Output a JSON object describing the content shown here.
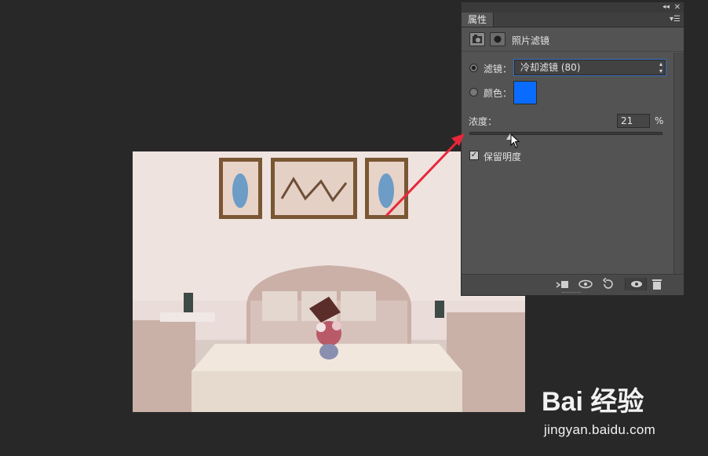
{
  "panel": {
    "tab_label": "属性",
    "title": "照片滤镜",
    "filter_label": "滤镜：",
    "filter_value": "冷却滤镜 (80)",
    "color_label": "颜色：",
    "color_hex": "#0a6cff",
    "density_label": "浓度：",
    "density_value": "21",
    "density_percent_sign": "%",
    "density": 21,
    "preserve_luminosity_label": "保留明度",
    "preserve_luminosity_checked": true,
    "filter_radio_selected": true
  },
  "watermark": {
    "logo": "Bai 经验",
    "url": "jingyan.baidu.com"
  },
  "colors": {
    "annotation_arrow": "#e8263a",
    "panel_bg": "#535353",
    "app_bg": "#282828"
  },
  "icons": {
    "collapse": "double-chevron-left-icon",
    "close": "close-icon",
    "panel_menu": "panel-menu-icon",
    "adjustment": "camera-filter-icon",
    "mask": "mask-icon",
    "clip": "clip-to-layer-icon",
    "view_previous": "view-previous-state-icon",
    "reset": "reset-icon",
    "visibility": "eye-icon",
    "delete": "trash-icon"
  }
}
